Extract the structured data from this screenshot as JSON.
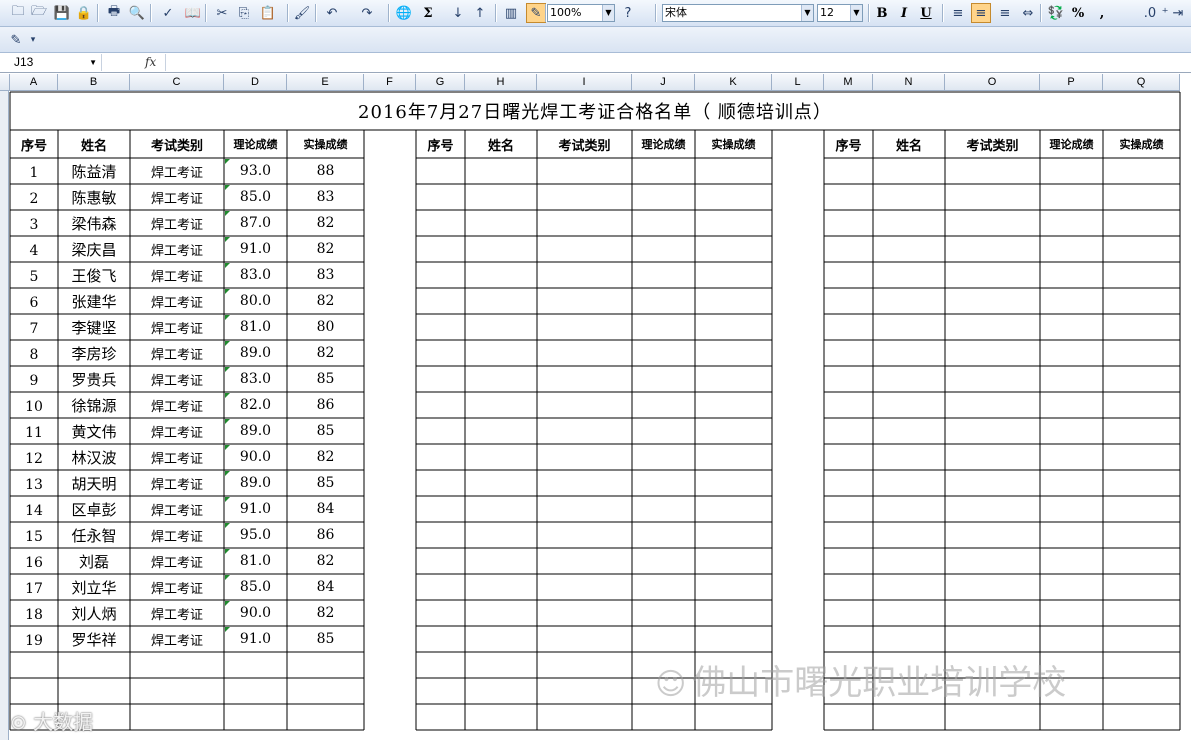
{
  "toolbar": {
    "zoom": "100%",
    "font_name": "宋体",
    "font_size": "12",
    "bold": "B",
    "italic": "I",
    "underline": "U",
    "percent": "%",
    "comma": ",",
    "sigma": "Σ",
    "zoom_arrow": "▼",
    "icons": [
      "new-icon",
      "open-icon",
      "save-icon",
      "permission-icon",
      "print-icon",
      "print-preview-icon",
      "spelling-icon",
      "research-icon",
      "cut-icon",
      "copy-icon",
      "paste-icon",
      "format-painter-icon",
      "undo-icon",
      "redo-icon",
      "hyperlink-icon",
      "autosum-icon",
      "sort-asc-icon",
      "sort-desc-icon",
      "chart-wizard-icon",
      "drawing-icon",
      "help-icon",
      "align-left-icon",
      "align-center-icon",
      "align-right-icon",
      "merge-center-icon",
      "currency-icon",
      "increase-decimal-icon",
      "decrease-decimal-icon",
      "indent-icon"
    ]
  },
  "formula_bar": {
    "name_box": "J13",
    "fx_label": "fx",
    "value": ""
  },
  "columns": [
    "A",
    "B",
    "C",
    "D",
    "E",
    "F",
    "G",
    "H",
    "I",
    "J",
    "K",
    "L",
    "M",
    "N",
    "O",
    "P",
    "Q"
  ],
  "sheet": {
    "title": "2016年7月27日曙光焊工考证合格名单（ 顺德培训点）",
    "headers": {
      "seq": "序号",
      "name": "姓名",
      "category": "考试类别",
      "theory": "理论成绩",
      "practice": "实操成绩"
    },
    "rows": [
      {
        "seq": "1",
        "name": "陈益清",
        "category": "焊工考证",
        "theory": "93.0",
        "practice": "88"
      },
      {
        "seq": "2",
        "name": "陈惠敏",
        "category": "焊工考证",
        "theory": "85.0",
        "practice": "83"
      },
      {
        "seq": "3",
        "name": "梁伟森",
        "category": "焊工考证",
        "theory": "87.0",
        "practice": "82"
      },
      {
        "seq": "4",
        "name": "梁庆昌",
        "category": "焊工考证",
        "theory": "91.0",
        "practice": "82"
      },
      {
        "seq": "5",
        "name": "王俊飞",
        "category": "焊工考证",
        "theory": "83.0",
        "practice": "83"
      },
      {
        "seq": "6",
        "name": "张建华",
        "category": "焊工考证",
        "theory": "80.0",
        "practice": "82"
      },
      {
        "seq": "7",
        "name": "李键坚",
        "category": "焊工考证",
        "theory": "81.0",
        "practice": "80"
      },
      {
        "seq": "8",
        "name": "李房珍",
        "category": "焊工考证",
        "theory": "89.0",
        "practice": "82"
      },
      {
        "seq": "9",
        "name": "罗贵兵",
        "category": "焊工考证",
        "theory": "83.0",
        "practice": "85"
      },
      {
        "seq": "10",
        "name": "徐锦源",
        "category": "焊工考证",
        "theory": "82.0",
        "practice": "86"
      },
      {
        "seq": "11",
        "name": "黄文伟",
        "category": "焊工考证",
        "theory": "89.0",
        "practice": "85"
      },
      {
        "seq": "12",
        "name": "林汉波",
        "category": "焊工考证",
        "theory": "90.0",
        "practice": "82"
      },
      {
        "seq": "13",
        "name": "胡天明",
        "category": "焊工考证",
        "theory": "89.0",
        "practice": "85"
      },
      {
        "seq": "14",
        "name": "区卓彭",
        "category": "焊工考证",
        "theory": "91.0",
        "practice": "84"
      },
      {
        "seq": "15",
        "name": "任永智",
        "category": "焊工考证",
        "theory": "95.0",
        "practice": "86"
      },
      {
        "seq": "16",
        "name": "刘磊",
        "category": "焊工考证",
        "theory": "81.0",
        "practice": "82"
      },
      {
        "seq": "17",
        "name": "刘立华",
        "category": "焊工考证",
        "theory": "85.0",
        "practice": "84"
      },
      {
        "seq": "18",
        "name": "刘人炳",
        "category": "焊工考证",
        "theory": "90.0",
        "practice": "82"
      },
      {
        "seq": "19",
        "name": "罗华祥",
        "category": "焊工考证",
        "theory": "91.0",
        "practice": "85"
      }
    ]
  },
  "watermarks": {
    "right": "佛山市曙光职业培训学校",
    "left": "大数据"
  },
  "colors": {
    "grid": "#000000",
    "header_bg": "#dfe7f1",
    "toolbar_bg": "#d6e2f3",
    "comment_marker": "#1f8a2d"
  }
}
